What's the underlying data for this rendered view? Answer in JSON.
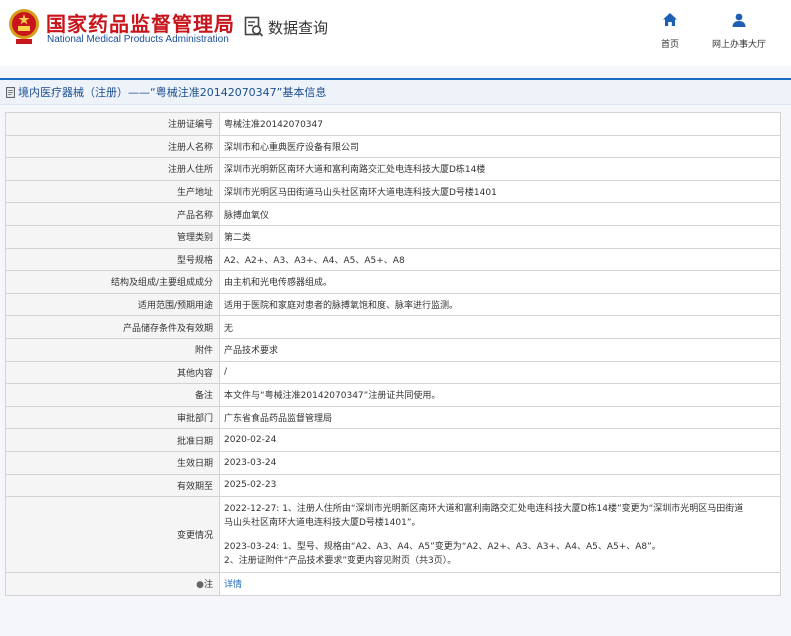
{
  "header": {
    "site_title": "国家药品监督管理局",
    "site_subtitle": "National Medical Products Administration",
    "query_label": "数据查询",
    "nav": {
      "home_label": "首页",
      "online_label": "网上办事大厅"
    }
  },
  "page_title": "境内医疗器械（注册）——“粤械注准20142070347”基本信息",
  "fields": [
    {
      "key": "注册证编号",
      "value": "粤械注准20142070347"
    },
    {
      "key": "注册人名称",
      "value": "深圳市和心重典医疗设备有限公司"
    },
    {
      "key": "注册人住所",
      "value": "深圳市光明新区南环大道和富利南路交汇处电连科技大厦D栋14楼"
    },
    {
      "key": "生产地址",
      "value": "深圳市光明区马田街道马山头社区南环大道电连科技大厦D号楼1401"
    },
    {
      "key": "产品名称",
      "value": "脉搏血氧仪"
    },
    {
      "key": "管理类别",
      "value": "第二类"
    },
    {
      "key": "型号规格",
      "value": "A2、A2+、A3、A3+、A4、A5、A5+、A8"
    },
    {
      "key": "结构及组成/主要组成成分",
      "value": "由主机和光电传感器组成。"
    },
    {
      "key": "适用范围/预期用途",
      "value": "适用于医院和家庭对患者的脉搏氧饱和度、脉率进行监测。"
    },
    {
      "key": "产品储存条件及有效期",
      "value": "无"
    },
    {
      "key": "附件",
      "value": "产品技术要求"
    },
    {
      "key": "其他内容",
      "value": "/"
    },
    {
      "key": "备注",
      "value": "本文件与“粤械注准20142070347”注册证共同使用。"
    },
    {
      "key": "审批部门",
      "value": "广东省食品药品监督管理局"
    },
    {
      "key": "批准日期",
      "value": "2020-02-24"
    },
    {
      "key": "生效日期",
      "value": "2023-03-24"
    },
    {
      "key": "有效期至",
      "value": "2025-02-23"
    }
  ],
  "change_history": {
    "key": "变更情况",
    "line1": "2022-12-27: 1、注册人住所由“深圳市光明新区南环大道和富利南路交汇处电连科技大厦D栋14楼”变更为“深圳市光明区马田街道",
    "line2": "马山头社区南环大道电连科技大厦D号楼1401”。",
    "line3": "2023-03-24: 1、型号、规格由“A2、A3、A4、A5”变更为“A2、A2+、A3、A3+、A4、A5、A5+、A8”。",
    "line4": "2、注册证附件“产品技术要求”变更内容见附页（共3页）。"
  },
  "note": {
    "key": "注",
    "link": "详情"
  },
  "colors": {
    "title_red": "#c8141b",
    "accent_blue": "#1d6cc0"
  }
}
